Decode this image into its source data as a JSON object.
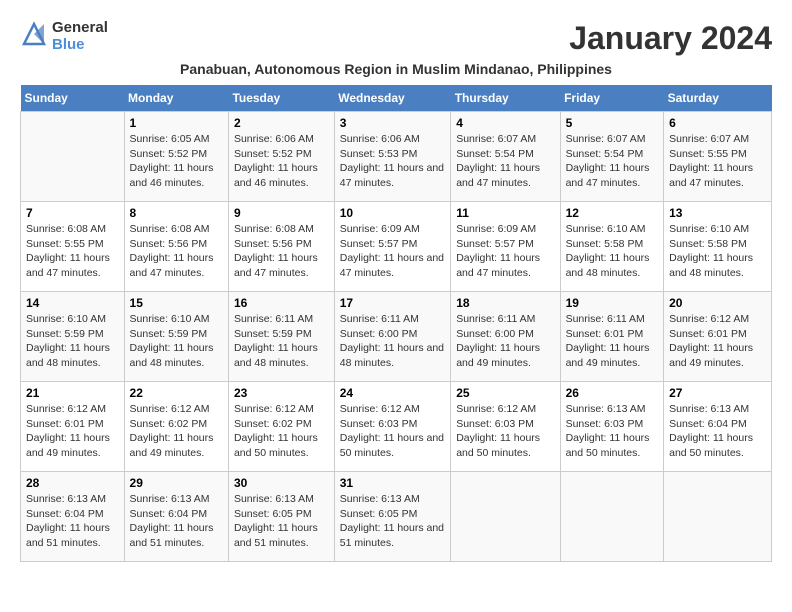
{
  "logo": {
    "general": "General",
    "blue": "Blue"
  },
  "title": "January 2024",
  "subtitle": "Panabuan, Autonomous Region in Muslim Mindanao, Philippines",
  "weekdays": [
    "Sunday",
    "Monday",
    "Tuesday",
    "Wednesday",
    "Thursday",
    "Friday",
    "Saturday"
  ],
  "weeks": [
    [
      {
        "day": "",
        "sunrise": "",
        "sunset": "",
        "daylight": ""
      },
      {
        "day": "1",
        "sunrise": "Sunrise: 6:05 AM",
        "sunset": "Sunset: 5:52 PM",
        "daylight": "Daylight: 11 hours and 46 minutes."
      },
      {
        "day": "2",
        "sunrise": "Sunrise: 6:06 AM",
        "sunset": "Sunset: 5:52 PM",
        "daylight": "Daylight: 11 hours and 46 minutes."
      },
      {
        "day": "3",
        "sunrise": "Sunrise: 6:06 AM",
        "sunset": "Sunset: 5:53 PM",
        "daylight": "Daylight: 11 hours and 47 minutes."
      },
      {
        "day": "4",
        "sunrise": "Sunrise: 6:07 AM",
        "sunset": "Sunset: 5:54 PM",
        "daylight": "Daylight: 11 hours and 47 minutes."
      },
      {
        "day": "5",
        "sunrise": "Sunrise: 6:07 AM",
        "sunset": "Sunset: 5:54 PM",
        "daylight": "Daylight: 11 hours and 47 minutes."
      },
      {
        "day": "6",
        "sunrise": "Sunrise: 6:07 AM",
        "sunset": "Sunset: 5:55 PM",
        "daylight": "Daylight: 11 hours and 47 minutes."
      }
    ],
    [
      {
        "day": "7",
        "sunrise": "Sunrise: 6:08 AM",
        "sunset": "Sunset: 5:55 PM",
        "daylight": "Daylight: 11 hours and 47 minutes."
      },
      {
        "day": "8",
        "sunrise": "Sunrise: 6:08 AM",
        "sunset": "Sunset: 5:56 PM",
        "daylight": "Daylight: 11 hours and 47 minutes."
      },
      {
        "day": "9",
        "sunrise": "Sunrise: 6:08 AM",
        "sunset": "Sunset: 5:56 PM",
        "daylight": "Daylight: 11 hours and 47 minutes."
      },
      {
        "day": "10",
        "sunrise": "Sunrise: 6:09 AM",
        "sunset": "Sunset: 5:57 PM",
        "daylight": "Daylight: 11 hours and 47 minutes."
      },
      {
        "day": "11",
        "sunrise": "Sunrise: 6:09 AM",
        "sunset": "Sunset: 5:57 PM",
        "daylight": "Daylight: 11 hours and 47 minutes."
      },
      {
        "day": "12",
        "sunrise": "Sunrise: 6:10 AM",
        "sunset": "Sunset: 5:58 PM",
        "daylight": "Daylight: 11 hours and 48 minutes."
      },
      {
        "day": "13",
        "sunrise": "Sunrise: 6:10 AM",
        "sunset": "Sunset: 5:58 PM",
        "daylight": "Daylight: 11 hours and 48 minutes."
      }
    ],
    [
      {
        "day": "14",
        "sunrise": "Sunrise: 6:10 AM",
        "sunset": "Sunset: 5:59 PM",
        "daylight": "Daylight: 11 hours and 48 minutes."
      },
      {
        "day": "15",
        "sunrise": "Sunrise: 6:10 AM",
        "sunset": "Sunset: 5:59 PM",
        "daylight": "Daylight: 11 hours and 48 minutes."
      },
      {
        "day": "16",
        "sunrise": "Sunrise: 6:11 AM",
        "sunset": "Sunset: 5:59 PM",
        "daylight": "Daylight: 11 hours and 48 minutes."
      },
      {
        "day": "17",
        "sunrise": "Sunrise: 6:11 AM",
        "sunset": "Sunset: 6:00 PM",
        "daylight": "Daylight: 11 hours and 48 minutes."
      },
      {
        "day": "18",
        "sunrise": "Sunrise: 6:11 AM",
        "sunset": "Sunset: 6:00 PM",
        "daylight": "Daylight: 11 hours and 49 minutes."
      },
      {
        "day": "19",
        "sunrise": "Sunrise: 6:11 AM",
        "sunset": "Sunset: 6:01 PM",
        "daylight": "Daylight: 11 hours and 49 minutes."
      },
      {
        "day": "20",
        "sunrise": "Sunrise: 6:12 AM",
        "sunset": "Sunset: 6:01 PM",
        "daylight": "Daylight: 11 hours and 49 minutes."
      }
    ],
    [
      {
        "day": "21",
        "sunrise": "Sunrise: 6:12 AM",
        "sunset": "Sunset: 6:01 PM",
        "daylight": "Daylight: 11 hours and 49 minutes."
      },
      {
        "day": "22",
        "sunrise": "Sunrise: 6:12 AM",
        "sunset": "Sunset: 6:02 PM",
        "daylight": "Daylight: 11 hours and 49 minutes."
      },
      {
        "day": "23",
        "sunrise": "Sunrise: 6:12 AM",
        "sunset": "Sunset: 6:02 PM",
        "daylight": "Daylight: 11 hours and 50 minutes."
      },
      {
        "day": "24",
        "sunrise": "Sunrise: 6:12 AM",
        "sunset": "Sunset: 6:03 PM",
        "daylight": "Daylight: 11 hours and 50 minutes."
      },
      {
        "day": "25",
        "sunrise": "Sunrise: 6:12 AM",
        "sunset": "Sunset: 6:03 PM",
        "daylight": "Daylight: 11 hours and 50 minutes."
      },
      {
        "day": "26",
        "sunrise": "Sunrise: 6:13 AM",
        "sunset": "Sunset: 6:03 PM",
        "daylight": "Daylight: 11 hours and 50 minutes."
      },
      {
        "day": "27",
        "sunrise": "Sunrise: 6:13 AM",
        "sunset": "Sunset: 6:04 PM",
        "daylight": "Daylight: 11 hours and 50 minutes."
      }
    ],
    [
      {
        "day": "28",
        "sunrise": "Sunrise: 6:13 AM",
        "sunset": "Sunset: 6:04 PM",
        "daylight": "Daylight: 11 hours and 51 minutes."
      },
      {
        "day": "29",
        "sunrise": "Sunrise: 6:13 AM",
        "sunset": "Sunset: 6:04 PM",
        "daylight": "Daylight: 11 hours and 51 minutes."
      },
      {
        "day": "30",
        "sunrise": "Sunrise: 6:13 AM",
        "sunset": "Sunset: 6:05 PM",
        "daylight": "Daylight: 11 hours and 51 minutes."
      },
      {
        "day": "31",
        "sunrise": "Sunrise: 6:13 AM",
        "sunset": "Sunset: 6:05 PM",
        "daylight": "Daylight: 11 hours and 51 minutes."
      },
      {
        "day": "",
        "sunrise": "",
        "sunset": "",
        "daylight": ""
      },
      {
        "day": "",
        "sunrise": "",
        "sunset": "",
        "daylight": ""
      },
      {
        "day": "",
        "sunrise": "",
        "sunset": "",
        "daylight": ""
      }
    ]
  ]
}
